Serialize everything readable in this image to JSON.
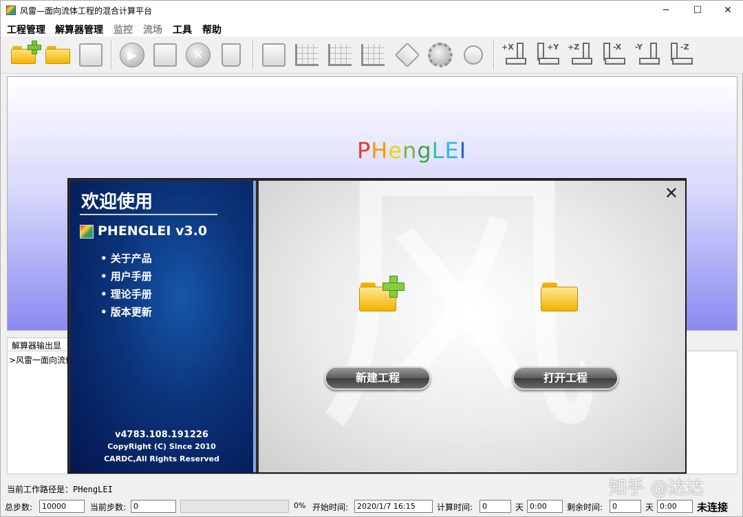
{
  "window": {
    "title": "风雷—面向流体工程的混合计算平台",
    "controls": [
      "─",
      "☐",
      "✕"
    ]
  },
  "menu": [
    "工程管理",
    "解算器管理",
    "监控",
    "流场",
    "工具",
    "帮助"
  ],
  "toolbar": {
    "axis_buttons": [
      "+X",
      "+Y",
      "+Z",
      "-X",
      "-Y",
      "-Z"
    ]
  },
  "viewer": {
    "brand_letters": [
      {
        "ch": "P",
        "color": "#e53935"
      },
      {
        "ch": "H",
        "color": "#ff9800"
      },
      {
        "ch": "e",
        "color": "#e8d41a"
      },
      {
        "ch": "n",
        "color": "#7cb342"
      },
      {
        "ch": "g",
        "color": "#43a047"
      },
      {
        "ch": "L",
        "color": "#26c6a8"
      },
      {
        "ch": "E",
        "color": "#29b6f6"
      },
      {
        "ch": "I",
        "color": "#1e64d8"
      }
    ]
  },
  "output": {
    "tab_label": "解算器输出显示",
    "first_line": ">风雷一面向流体"
  },
  "dialog": {
    "welcome": "欢迎使用",
    "product_name": "PHENGLEI  v3.0",
    "links": [
      "• 关于产品",
      "• 用户手册",
      "• 理论手册",
      "• 版本更新"
    ],
    "version": "v4783.108.191226",
    "copyright": "CopyRight (C) Since 2010",
    "rights": "CARDC,All Rights Reserved",
    "close": "✕",
    "new_project": "新建工程",
    "open_project": "打开工程",
    "watermark_char": "风"
  },
  "status": {
    "work_path": "当前工作路径是：PHengLEI",
    "total_steps_label": "总步数:",
    "total_steps": "10000",
    "current_step_label": "当前步数:",
    "current_step": "0",
    "progress_percent": "0%",
    "start_time_label": "开始时间:",
    "start_time": "2020/1/7 16:15",
    "calc_time_label": "计算时间:",
    "calc_days": "0",
    "day_unit_1": "天",
    "calc_clock": "0:00",
    "remaining_label": "剩余时间:",
    "remain_days": "0",
    "day_unit_2": "天",
    "remain_clock": "0:00",
    "connection": "未连接"
  },
  "overlay_watermark": "知乎 @达达"
}
